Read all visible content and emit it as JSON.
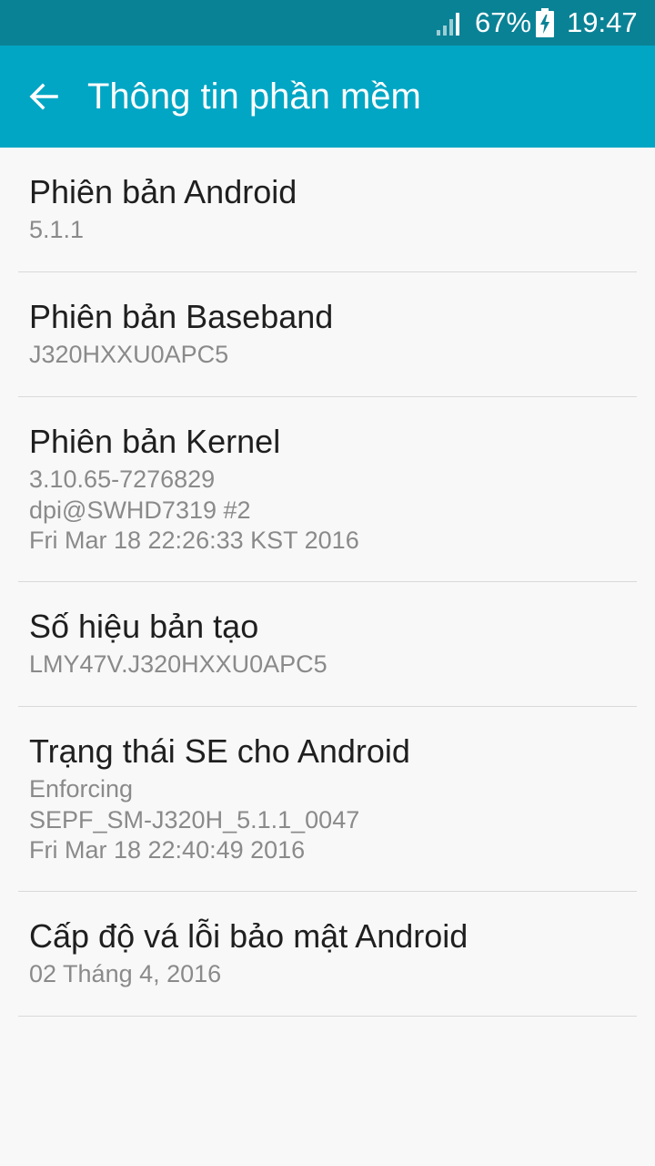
{
  "status_bar": {
    "battery_percent": "67%",
    "time": "19:47",
    "signal_icon": "signal-icon",
    "battery_icon": "battery-charging-icon"
  },
  "app_bar": {
    "back_icon": "back-arrow-icon",
    "title": "Thông tin phần mềm"
  },
  "items": [
    {
      "title": "Phiên bản Android",
      "lines": [
        "5.1.1"
      ]
    },
    {
      "title": "Phiên bản Baseband",
      "lines": [
        "J320HXXU0APC5"
      ]
    },
    {
      "title": "Phiên bản Kernel",
      "lines": [
        "3.10.65-7276829",
        "dpi@SWHD7319 #2",
        "Fri Mar 18 22:26:33 KST 2016"
      ]
    },
    {
      "title": "Số hiệu bản tạo",
      "lines": [
        "LMY47V.J320HXXU0APC5"
      ]
    },
    {
      "title": "Trạng thái SE cho Android",
      "lines": [
        "Enforcing",
        "SEPF_SM-J320H_5.1.1_0047",
        "Fri Mar 18 22:40:49 2016"
      ]
    },
    {
      "title": "Cấp độ vá lỗi bảo mật Android",
      "lines": [
        "02 Tháng 4, 2016"
      ]
    }
  ],
  "colors": {
    "status_bar": "#0a8296",
    "app_bar": "#01a6c4",
    "background": "#f8f8f8"
  }
}
